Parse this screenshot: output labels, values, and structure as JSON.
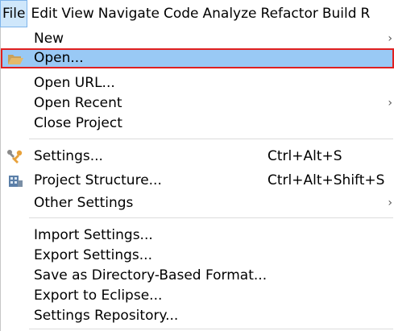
{
  "menubar": {
    "items": [
      "File",
      "Edit",
      "View",
      "Navigate",
      "Code",
      "Analyze",
      "Refactor",
      "Build",
      "R"
    ]
  },
  "file_menu": {
    "new": {
      "label": "New"
    },
    "open": {
      "label": "Open..."
    },
    "open_url": {
      "label": "Open URL..."
    },
    "open_recent": {
      "label": "Open Recent"
    },
    "close_project": {
      "label": "Close Project"
    },
    "settings": {
      "label": "Settings...",
      "shortcut": "Ctrl+Alt+S"
    },
    "project_structure": {
      "label": "Project Structure...",
      "shortcut": "Ctrl+Alt+Shift+S"
    },
    "other_settings": {
      "label": "Other Settings"
    },
    "import_settings": {
      "label": "Import Settings..."
    },
    "export_settings": {
      "label": "Export Settings..."
    },
    "save_as_directory": {
      "label": "Save as Directory-Based Format..."
    },
    "export_to_eclipse": {
      "label": "Export to Eclipse..."
    },
    "settings_repository": {
      "label": "Settings Repository..."
    },
    "submenu_arrow": "›"
  },
  "colors": {
    "selection": "#99c9f5",
    "highlight_border": "#e02020",
    "active_menu": "#cfe7fb"
  }
}
